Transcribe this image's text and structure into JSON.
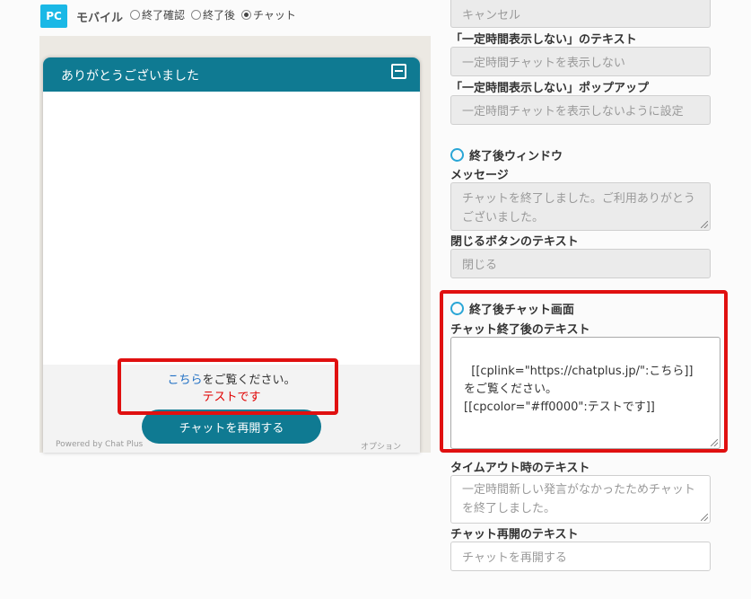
{
  "device": {
    "pc_label": "PC",
    "mobile_label": "モバイル",
    "radios": [
      {
        "label": "終了確認",
        "checked": false
      },
      {
        "label": "終了後",
        "checked": false
      },
      {
        "label": "チャット",
        "checked": true
      }
    ]
  },
  "preview": {
    "title": "ありがとうございました",
    "message_link": "こちら",
    "message_rest": "をご覧ください。",
    "message_red": "テストです",
    "restart_button": "チャットを再開する",
    "powered_by": "Powered by Chat Plus",
    "options": "オプション"
  },
  "form": {
    "cancel_field": "キャンセル",
    "hide_text_label": "「一定時間表示しない」のテキスト",
    "hide_text_value": "一定時間チャットを表示しない",
    "hide_popup_label": "「一定時間表示しない」ポップアップ",
    "hide_popup_value": "一定時間チャットを表示しないように設定",
    "after_window_title": "終了後ウィンドウ",
    "message_label": "メッセージ",
    "message_value": "チャットを終了しました。ご利用ありがとうございました。",
    "close_button_label": "閉じるボタンのテキスト",
    "close_button_value": "閉じる",
    "after_chat_title": "終了後チャット画面",
    "after_chat_text_label": "チャット終了後のテキスト",
    "after_chat_text_value": "[[cplink=\"https://chatplus.jp/\":こちら]]\nをご覧ください。\n[[cpcolor=\"#ff0000\":テストです]]",
    "timeout_label": "タイムアウト時のテキスト",
    "timeout_value": "一定時間新しい発言がなかったためチャットを終了しました。",
    "restart_label": "チャット再開のテキスト",
    "restart_value": "チャットを再開する"
  },
  "colors": {
    "accent": "#0f7a92",
    "highlight": "#e01010",
    "red_text": "#ff0000",
    "pc_badge": "#1ab8e6"
  }
}
